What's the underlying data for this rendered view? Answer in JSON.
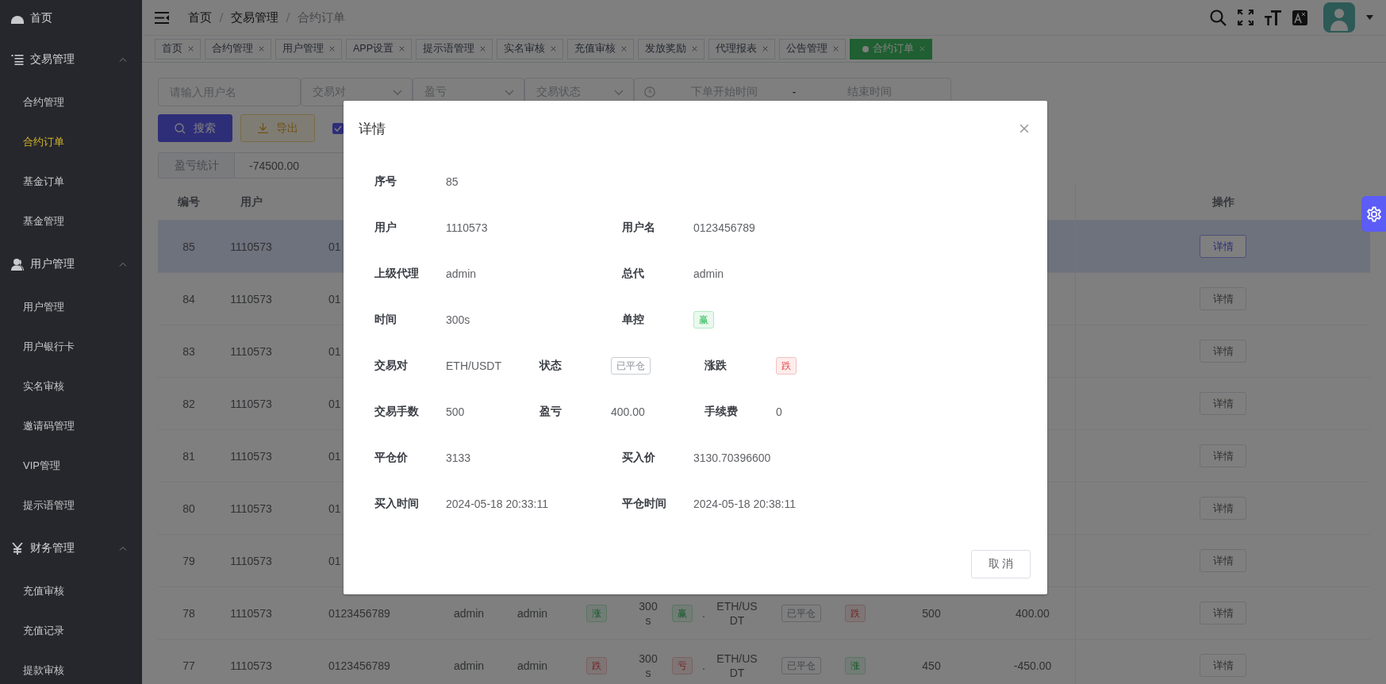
{
  "sidebar": {
    "items": [
      {
        "label": "首页",
        "kind": "link",
        "selected": false
      },
      {
        "label": "交易管理",
        "kind": "group",
        "expanded": true,
        "children": [
          {
            "label": "合约管理",
            "selected": false
          },
          {
            "label": "合约订单",
            "selected": true
          },
          {
            "label": "基金订单",
            "selected": false
          },
          {
            "label": "基金管理",
            "selected": false
          }
        ]
      },
      {
        "label": "用户管理",
        "kind": "group",
        "expanded": true,
        "children": [
          {
            "label": "用户管理",
            "selected": false
          },
          {
            "label": "用户银行卡",
            "selected": false
          },
          {
            "label": "实名审核",
            "selected": false
          },
          {
            "label": "邀请码管理",
            "selected": false
          },
          {
            "label": "VIP管理",
            "selected": false
          },
          {
            "label": "提示语管理",
            "selected": false
          }
        ]
      },
      {
        "label": "财务管理",
        "kind": "group",
        "expanded": true,
        "children": [
          {
            "label": "充值审核",
            "selected": false
          },
          {
            "label": "充值记录",
            "selected": false
          },
          {
            "label": "提款审核",
            "selected": false
          }
        ]
      }
    ]
  },
  "header": {
    "breadcrumb": [
      {
        "label": "首页"
      },
      {
        "label": "交易管理"
      },
      {
        "label": "合约订单"
      }
    ]
  },
  "tabs": [
    {
      "label": "首页",
      "selected": false
    },
    {
      "label": "合约管理",
      "selected": false
    },
    {
      "label": "用户管理",
      "selected": false
    },
    {
      "label": "APP设置",
      "selected": false
    },
    {
      "label": "提示语管理",
      "selected": false
    },
    {
      "label": "实名审核",
      "selected": false
    },
    {
      "label": "充值审核",
      "selected": false
    },
    {
      "label": "发放奖励",
      "selected": false
    },
    {
      "label": "代理报表",
      "selected": false
    },
    {
      "label": "公告管理",
      "selected": false
    },
    {
      "label": "合约订单",
      "selected": true
    }
  ],
  "filters": {
    "username": {
      "placeholder": "请输入用户名"
    },
    "selects": [
      {
        "placeholder": "交易对"
      },
      {
        "placeholder": "盈亏"
      },
      {
        "placeholder": "交易状态"
      }
    ],
    "date_range": {
      "start_placeholder": "下单开始时间",
      "separator": "-",
      "end_placeholder": "结束时间"
    }
  },
  "actions": {
    "buttons": [
      {
        "label": "搜索",
        "kind": "primary"
      },
      {
        "label": "导出",
        "kind": "warning"
      }
    ],
    "checkbox": {
      "checked": true
    }
  },
  "stats": {
    "label": "盈亏统计",
    "value": "-74500.00"
  },
  "table": {
    "columns": [
      {
        "label": "编号"
      },
      {
        "label": "用户"
      },
      {
        "label": "操作"
      }
    ],
    "rows": [
      {
        "selected": true,
        "cells": [
          {
            "kind": "text",
            "text": "85"
          },
          {
            "kind": "text",
            "text": "1110573"
          },
          {
            "kind": "text",
            "text": "01"
          }
        ],
        "action": "详情"
      },
      {
        "selected": false,
        "cells": [
          {
            "kind": "text",
            "text": "84"
          },
          {
            "kind": "text",
            "text": "1110573"
          },
          {
            "kind": "text",
            "text": "01"
          }
        ],
        "action": "详情"
      },
      {
        "selected": false,
        "cells": [
          {
            "kind": "text",
            "text": "83"
          },
          {
            "kind": "text",
            "text": "1110573"
          },
          {
            "kind": "text",
            "text": "01"
          }
        ],
        "action": "详情"
      },
      {
        "selected": false,
        "cells": [
          {
            "kind": "text",
            "text": "82"
          },
          {
            "kind": "text",
            "text": "1110573"
          },
          {
            "kind": "text",
            "text": "01"
          }
        ],
        "action": "详情"
      },
      {
        "selected": false,
        "cells": [
          {
            "kind": "text",
            "text": "81"
          },
          {
            "kind": "text",
            "text": "1110573"
          },
          {
            "kind": "text",
            "text": "01"
          }
        ],
        "action": "详情"
      },
      {
        "selected": false,
        "cells": [
          {
            "kind": "text",
            "text": "80"
          },
          {
            "kind": "text",
            "text": "1110573"
          },
          {
            "kind": "text",
            "text": "01"
          }
        ],
        "action": "详情"
      },
      {
        "selected": false,
        "cells": [
          {
            "kind": "text",
            "text": "79"
          },
          {
            "kind": "text",
            "text": "1110573"
          },
          {
            "kind": "text",
            "text": "01"
          }
        ],
        "action": "详情"
      },
      {
        "selected": false,
        "cells": [
          {
            "kind": "text",
            "text": "78"
          },
          {
            "kind": "text",
            "text": "1110573"
          },
          {
            "kind": "text",
            "text": "0123456789"
          },
          {
            "kind": "text",
            "text": "admin"
          },
          {
            "kind": "text",
            "text": "admin"
          },
          {
            "kind": "success",
            "text": "涨"
          },
          {
            "kind": "text",
            "text": "300s"
          },
          {
            "kind": "success",
            "text": "赢"
          },
          {
            "kind": "text",
            "text": "."
          },
          {
            "kind": "text",
            "text": "ETH/USDT"
          },
          {
            "kind": "plain",
            "text": "已平仓"
          },
          {
            "kind": "danger",
            "text": "跌"
          },
          {
            "kind": "text",
            "text": "500"
          },
          {
            "kind": "text",
            "text": "400.00"
          }
        ],
        "action": "详情"
      },
      {
        "selected": false,
        "cells": [
          {
            "kind": "text",
            "text": "77"
          },
          {
            "kind": "text",
            "text": "1110573"
          },
          {
            "kind": "text",
            "text": "0123456789"
          },
          {
            "kind": "text",
            "text": "admin"
          },
          {
            "kind": "text",
            "text": "admin"
          },
          {
            "kind": "danger",
            "text": "跌"
          },
          {
            "kind": "text",
            "text": "300s"
          },
          {
            "kind": "danger",
            "text": "亏"
          },
          {
            "kind": "text",
            "text": "."
          },
          {
            "kind": "text",
            "text": "ETH/USDT"
          },
          {
            "kind": "plain",
            "text": "已平仓"
          },
          {
            "kind": "success",
            "text": "涨"
          },
          {
            "kind": "text",
            "text": "450"
          },
          {
            "kind": "text",
            "text": "-450.00"
          }
        ],
        "action": "详情"
      }
    ]
  },
  "dialog": {
    "title": "详情",
    "rows": [
      {
        "fields": [
          {
            "label": "序号",
            "kind": "text",
            "value": "85"
          }
        ]
      },
      {
        "fields": [
          {
            "label": "用户",
            "kind": "text",
            "value": "1110573"
          },
          {
            "label": "用户名",
            "kind": "text",
            "value": "0123456789"
          }
        ]
      },
      {
        "fields": [
          {
            "label": "上级代理",
            "kind": "text",
            "value": "admin"
          },
          {
            "label": "总代",
            "kind": "text",
            "value": "admin"
          }
        ]
      },
      {
        "fields": [
          {
            "label": "时间",
            "kind": "text",
            "value": "300s"
          },
          {
            "label": "单控",
            "kind": "success",
            "value": "赢"
          }
        ]
      },
      {
        "fields": [
          {
            "label": "交易对",
            "kind": "text",
            "value": "ETH/USDT"
          },
          {
            "label": "状态",
            "kind": "plain",
            "value": "已平仓"
          },
          {
            "label": "涨跌",
            "kind": "danger",
            "value": "跌"
          }
        ]
      },
      {
        "fields": [
          {
            "label": "交易手数",
            "kind": "text",
            "value": "500"
          },
          {
            "label": "盈亏",
            "kind": "text",
            "value": "400.00"
          },
          {
            "label": "手续费",
            "kind": "text",
            "value": "0"
          }
        ]
      },
      {
        "fields": [
          {
            "label": "平仓价",
            "kind": "text",
            "value": "3133"
          },
          {
            "label": "买入价",
            "kind": "text",
            "value": "3130.70396600"
          }
        ]
      },
      {
        "fields": [
          {
            "label": "买入时间",
            "kind": "text",
            "value": "2024-05-18 20:33:11"
          },
          {
            "label": "平仓时间",
            "kind": "text",
            "value": "2024-05-18 20:38:11"
          }
        ]
      }
    ],
    "cancel": "取 消"
  }
}
